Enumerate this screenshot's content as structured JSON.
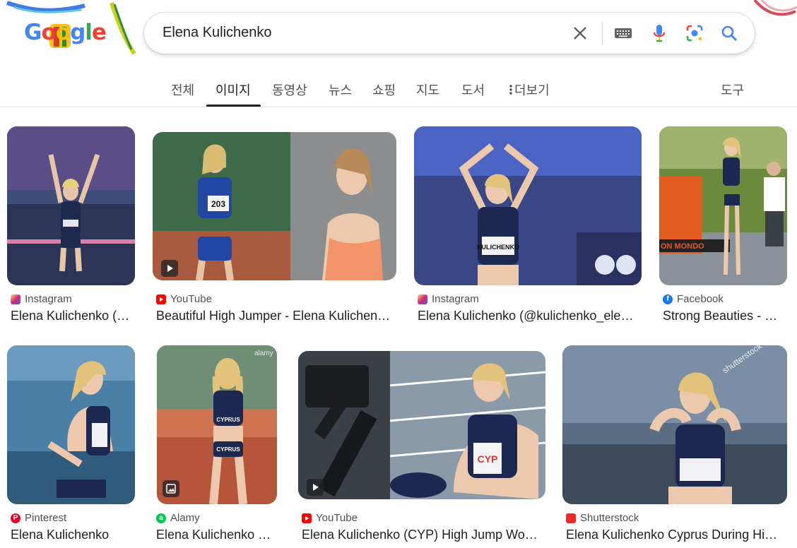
{
  "logo": {
    "alt": "Google",
    "letters": [
      "G",
      "o",
      "o",
      "g",
      "l",
      "e"
    ]
  },
  "search": {
    "query": "Elena Kulichenko"
  },
  "tabs": [
    {
      "label": "전체",
      "active": false
    },
    {
      "label": "이미지",
      "active": true
    },
    {
      "label": "동영상",
      "active": false
    },
    {
      "label": "뉴스",
      "active": false
    },
    {
      "label": "쇼핑",
      "active": false
    },
    {
      "label": "지도",
      "active": false
    },
    {
      "label": "도서",
      "active": false
    },
    {
      "label": "더보기",
      "active": false
    }
  ],
  "tools_label": "도구",
  "results": [
    {
      "source": "Instagram",
      "source_icon": "instagram-icon",
      "source_color": "#d6249f",
      "title": "Elena Kulichenko (…",
      "badge": ""
    },
    {
      "source": "YouTube",
      "source_icon": "youtube-icon",
      "source_color": "#ff0000",
      "title": "Beautiful High Jumper - Elena Kulichen…",
      "badge": "play-icon"
    },
    {
      "source": "Instagram",
      "source_icon": "instagram-icon",
      "source_color": "#d6249f",
      "title": "Elena Kulichenko (@kulichenko_ele…",
      "badge": ""
    },
    {
      "source": "Facebook",
      "source_icon": "facebook-icon",
      "source_color": "#1877f2",
      "title": "Strong Beauties - …",
      "badge": ""
    },
    {
      "source": "Pinterest",
      "source_icon": "pinterest-icon",
      "source_color": "#e60023",
      "title": "Elena Kulichenko",
      "badge": ""
    },
    {
      "source": "Alamy",
      "source_icon": "alamy-icon",
      "source_color": "#00c853",
      "title": "Elena Kulichenko …",
      "badge": "image-icon"
    },
    {
      "source": "YouTube",
      "source_icon": "youtube-icon",
      "source_color": "#ff0000",
      "title": "Elena Kulichenko (CYP) High Jump Wo…",
      "badge": "play-icon"
    },
    {
      "source": "Shutterstock",
      "source_icon": "shutterstock-icon",
      "source_color": "#ee2b24",
      "title": "Elena Kulichenko Cyprus During Hi…",
      "badge": ""
    }
  ],
  "thumb_texts": {
    "bib_1": "203",
    "bib_2": "KULICHENKO",
    "ad_banner": "ON MONDO",
    "shirt_1": "CYPRUS",
    "shirt_2": "CYPRUS",
    "bib_3": "CYP",
    "watermark_alamy": "alamy",
    "watermark_shutterstock": "shutterstock"
  }
}
